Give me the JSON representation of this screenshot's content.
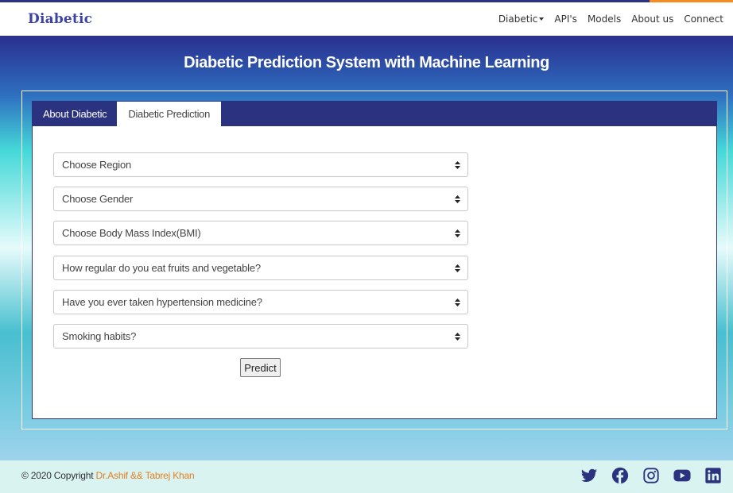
{
  "navbar": {
    "brand": "Diabetic",
    "links": [
      "Diabetic",
      "API's",
      "Models",
      "About us",
      "Connect"
    ]
  },
  "hero": {
    "title": "Diabetic Prediction System with Machine Learning"
  },
  "tabs": [
    "About Diabetic",
    "Diabetic Prediction"
  ],
  "active_tab": "Diabetic Prediction",
  "form": {
    "selects": [
      "Choose Region",
      "Choose Gender",
      "Choose Body Mass Index(BMI)",
      "How regular do you eat fruits and vegetable?",
      "Have you ever taken hypertension medicine?",
      "Smoking habits?"
    ],
    "predict_label": "Predict"
  },
  "footer": {
    "copyright": "© 2020 Copyright",
    "authors": "Dr.Ashif && Tabrej Khan",
    "social_icons": [
      "twitter-icon",
      "facebook-icon",
      "instagram-icon",
      "youtube-icon",
      "linkedin-icon"
    ]
  },
  "colors": {
    "brand": "#3d43a6",
    "nav_dark": "#2b3380",
    "accent_orange": "#f58b1f",
    "footer_bg": "#d9f3f1",
    "icon_color": "#2b3380"
  }
}
